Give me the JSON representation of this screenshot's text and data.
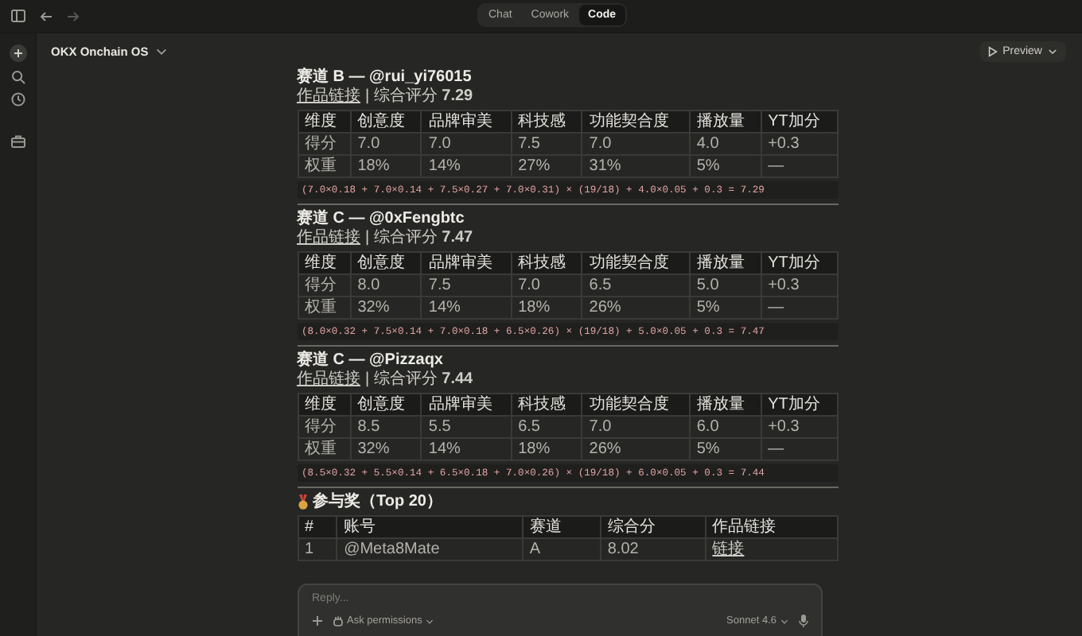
{
  "tabs": [
    {
      "label": "Chat",
      "selected": false
    },
    {
      "label": "Cowork",
      "selected": false
    },
    {
      "label": "Code",
      "selected": true
    }
  ],
  "header": {
    "project": "OKX Onchain OS",
    "preview": "Preview"
  },
  "sections": [
    {
      "title": "赛道 B — @rui_yi76015",
      "link": "作品链接",
      "score": "| 综合评分 **7.29**",
      "columns": [
        "维度",
        "创意度",
        "品牌审美",
        "科技感",
        "功能契合度",
        "播放量",
        "YT加分"
      ],
      "rows": [
        [
          "得分",
          "7.0",
          "7.0",
          "7.5",
          "7.0",
          "4.0",
          "+0.3"
        ],
        [
          "权重",
          "18%",
          "14%",
          "27%",
          "31%",
          "5%",
          "—"
        ]
      ],
      "formula": "(7.0×0.18 + 7.0×0.14 + 7.5×0.27 + 7.0×0.31) × (19/18) + 4.0×0.05 + 0.3 = 7.29"
    },
    {
      "title": "赛道 C — @0xFengbtc",
      "link": "作品链接",
      "score": "| 综合评分 **7.47**",
      "columns": [
        "维度",
        "创意度",
        "品牌审美",
        "科技感",
        "功能契合度",
        "播放量",
        "YT加分"
      ],
      "rows": [
        [
          "得分",
          "8.0",
          "7.5",
          "7.0",
          "6.5",
          "5.0",
          "+0.3"
        ],
        [
          "权重",
          "32%",
          "14%",
          "18%",
          "26%",
          "5%",
          "—"
        ]
      ],
      "formula": "(8.0×0.32 + 7.5×0.14 + 7.0×0.18 + 6.5×0.26) × (19/18) + 5.0×0.05 + 0.3 = 7.47"
    },
    {
      "title": "赛道 C — @Pizzaqx",
      "link": "作品链接",
      "score": "| 综合评分 **7.44**",
      "columns": [
        "维度",
        "创意度",
        "品牌审美",
        "科技感",
        "功能契合度",
        "播放量",
        "YT加分"
      ],
      "rows": [
        [
          "得分",
          "8.5",
          "5.5",
          "6.5",
          "7.0",
          "6.0",
          "+0.3"
        ],
        [
          "权重",
          "32%",
          "14%",
          "18%",
          "26%",
          "5%",
          "—"
        ]
      ],
      "formula": "(8.5×0.32 + 5.5×0.14 + 6.5×0.18 + 7.0×0.26) × (19/18) + 6.0×0.05 + 0.3 = 7.44"
    }
  ],
  "awards": {
    "title": "参与奖（Top 20）",
    "columns": [
      "#",
      "账号",
      "赛道",
      "综合分",
      "作品链接"
    ],
    "rows": [
      {
        "cells": [
          "1",
          "@Meta8Mate",
          "A",
          "8.02"
        ],
        "link": "链接"
      }
    ]
  },
  "composer": {
    "placeholder": "Reply...",
    "permissions": "Ask permissions",
    "model": "Sonnet 4.6"
  }
}
